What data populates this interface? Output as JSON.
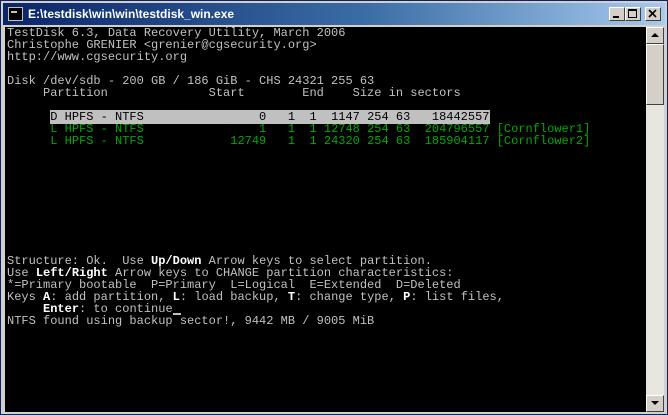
{
  "window": {
    "title": "E:\\testdisk\\win\\win\\testdisk_win.exe"
  },
  "console": {
    "header": {
      "line1": "TestDisk 6.3, Data Recovery Utility, March 2006",
      "line2": "Christophe GRENIER <grenier@cgsecurity.org>",
      "line3": "http://www.cgsecurity.org"
    },
    "disk_line": "Disk /dev/sdb - 200 GB / 186 GiB - CHS 24321 255 63",
    "table_header": "     Partition              Start        End    Size in sectors",
    "partitions": [
      {
        "text": "D HPFS - NTFS                0   1  1  1147 254 63   18442557",
        "label": "",
        "status": "deleted",
        "selected": true
      },
      {
        "text": "L HPFS - NTFS                1   1  1 12748 254 63  204796557",
        "label": "[Cornflower1]",
        "status": "logical",
        "selected": false
      },
      {
        "text": "L HPFS - NTFS            12749   1  1 24320 254 63  185904117",
        "label": "[Cornflower2]",
        "status": "logical",
        "selected": false
      }
    ],
    "footer": {
      "structure_a": "Structure: Ok.  Use ",
      "updown": "Up/Down",
      "structure_b": " Arrow keys to select partition.",
      "use": "Use ",
      "leftright": "Left/Right",
      "change_b": " Arrow keys to CHANGE partition characteristics:",
      "legend": "*=Primary bootable  P=Primary  L=Logical  E=Extended  D=Deleted",
      "keys": "Keys ",
      "key_a": "A",
      "keys_b": ": add partition, ",
      "key_l": "L",
      "keys_c": ": load backup, ",
      "key_t": "T",
      "keys_d": ": change type, ",
      "key_p": "P",
      "keys_e": ": list files,",
      "enter_indent": "     ",
      "enter": "Enter",
      "enter_b": ": to continue",
      "status": "NTFS found using backup sector!, 9442 MB / 9005 MiB"
    }
  }
}
